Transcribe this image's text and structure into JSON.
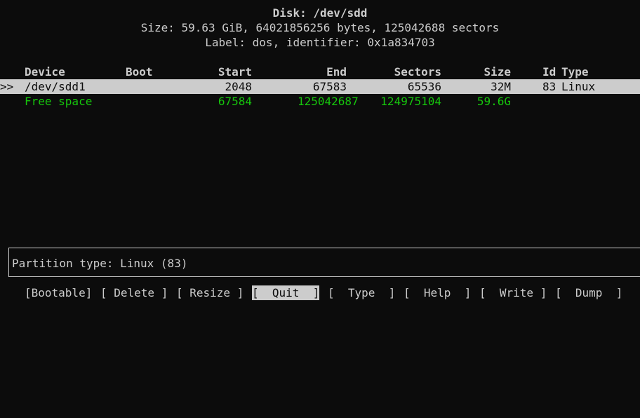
{
  "disk": {
    "title": "Disk: /dev/sdd",
    "size_line": "Size: 59.63 GiB, 64021856256 bytes, 125042688 sectors",
    "label_line": "Label: dos, identifier: 0x1a834703"
  },
  "table": {
    "columns": [
      "Device",
      "Boot",
      "Start",
      "End",
      "Sectors",
      "Size",
      "Id",
      "Type"
    ],
    "rows": [
      {
        "marker": ">>",
        "device": "/dev/sdd1",
        "boot": "",
        "start": "2048",
        "end": "67583",
        "sectors": "65536",
        "size": "32M",
        "id": "83",
        "type": "Linux",
        "selected": true
      },
      {
        "marker": "",
        "device": "Free space",
        "boot": "",
        "start": "67584",
        "end": "125042687",
        "sectors": "124975104",
        "size": "59.6G",
        "id": "",
        "type": "",
        "selected": false
      }
    ]
  },
  "info": {
    "text": "Partition type: Linux (83)"
  },
  "menu": {
    "bootable": "[Bootable]",
    "delete": "[ Delete ]",
    "resize": "[ Resize ]",
    "quit": "[  Quit  ]",
    "type": "[  Type  ]",
    "help": "[  Help  ]",
    "write": "[  Write ]",
    "dump": "[  Dump  ]",
    "active": "quit"
  },
  "colors": {
    "background": "#0c0c0c",
    "foreground": "#cccccc",
    "free_space": "#16c60c",
    "selection_bg": "#cccccc"
  }
}
